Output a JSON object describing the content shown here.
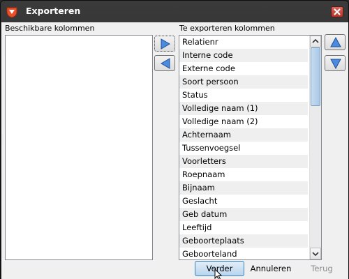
{
  "window": {
    "title": "Exporteren",
    "icon": "app-logo-icon",
    "close": "close-icon"
  },
  "left_panel": {
    "label": "Beschikbare kolommen",
    "items": []
  },
  "right_panel": {
    "label": "Te exporteren kolommen",
    "items": [
      "Relatienr",
      "Interne code",
      "Externe code",
      "Soort persoon",
      "Status",
      "Volledige naam (1)",
      "Volledige naam (2)",
      "Achternaam",
      "Tussenvoegsel",
      "Voorletters",
      "Roepnaam",
      "Bijnaam",
      "Geslacht",
      "Geb datum",
      "Leeftijd",
      "Geboorteplaats",
      "Geboorteland"
    ]
  },
  "move_buttons": {
    "add": "arrow-right-icon",
    "remove": "arrow-left-icon"
  },
  "order_buttons": {
    "up": "arrow-up-icon",
    "down": "arrow-down-icon"
  },
  "footer": {
    "next_label": "Verder",
    "cancel_label": "Annuleren",
    "back_label": "Terug"
  },
  "colors": {
    "titlebar": "#2a2a2a",
    "close_button": "#c9463d",
    "accent_arrow": "#3f7fd4",
    "primary_button_border": "#3c7fb1",
    "disabled_text": "#8d8d8d"
  }
}
